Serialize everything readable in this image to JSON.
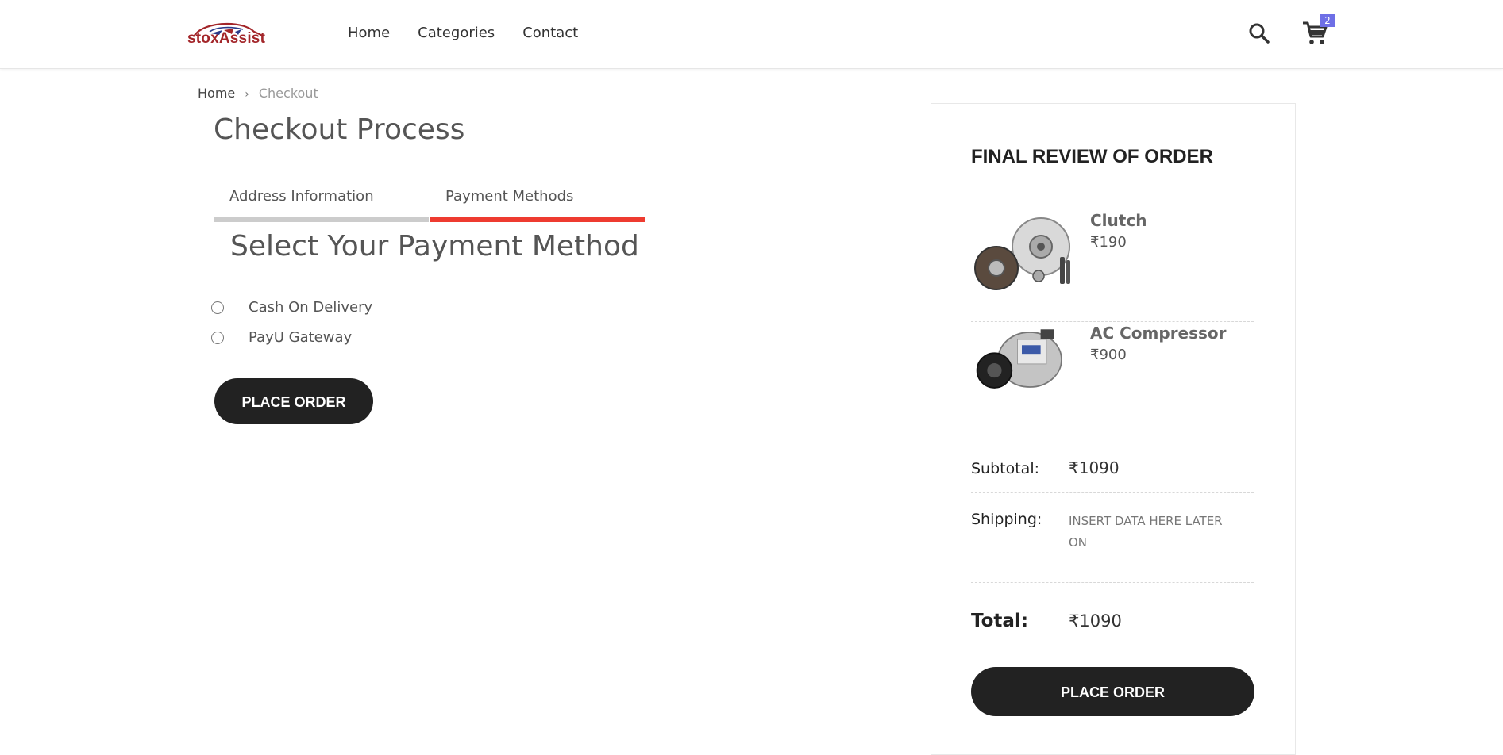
{
  "header": {
    "logo_text": "stoxAssist",
    "nav": [
      "Home",
      "Categories",
      "Contact"
    ],
    "cart_count": "2",
    "icons": [
      "search-icon",
      "cart-icon"
    ]
  },
  "breadcrumb": {
    "home": "Home",
    "separator": "›",
    "current": "Checkout"
  },
  "page": {
    "title": "Checkout Process",
    "tabs": [
      "Address Information",
      "Payment Methods"
    ],
    "active_tab": "Payment Methods",
    "section_title": "Select Your Payment Method",
    "payment_options": [
      "Cash On Delivery",
      "PayU Gateway"
    ],
    "place_order_label": "PLACE ORDER"
  },
  "review": {
    "title": "FINAL REVIEW OF ORDER",
    "items": [
      {
        "name": "Clutch",
        "price": "₹190",
        "icon": "clutch-image"
      },
      {
        "name": "AC Compressor",
        "price": "₹900",
        "icon": "ac-compressor-image"
      }
    ],
    "subtotal_label": "Subtotal:",
    "subtotal_value": "₹1090",
    "shipping_label": "Shipping:",
    "shipping_value": "INSERT DATA HERE LATER ON",
    "total_label": "Total:",
    "total_value": "₹1090",
    "place_order_label": "PLACE ORDER"
  },
  "colors": {
    "accent_red": "#ee3b30",
    "tab_inactive": "#cccccc",
    "button_dark": "#222222",
    "badge": "#6e6fe6",
    "logo_red": "#a3262a"
  }
}
